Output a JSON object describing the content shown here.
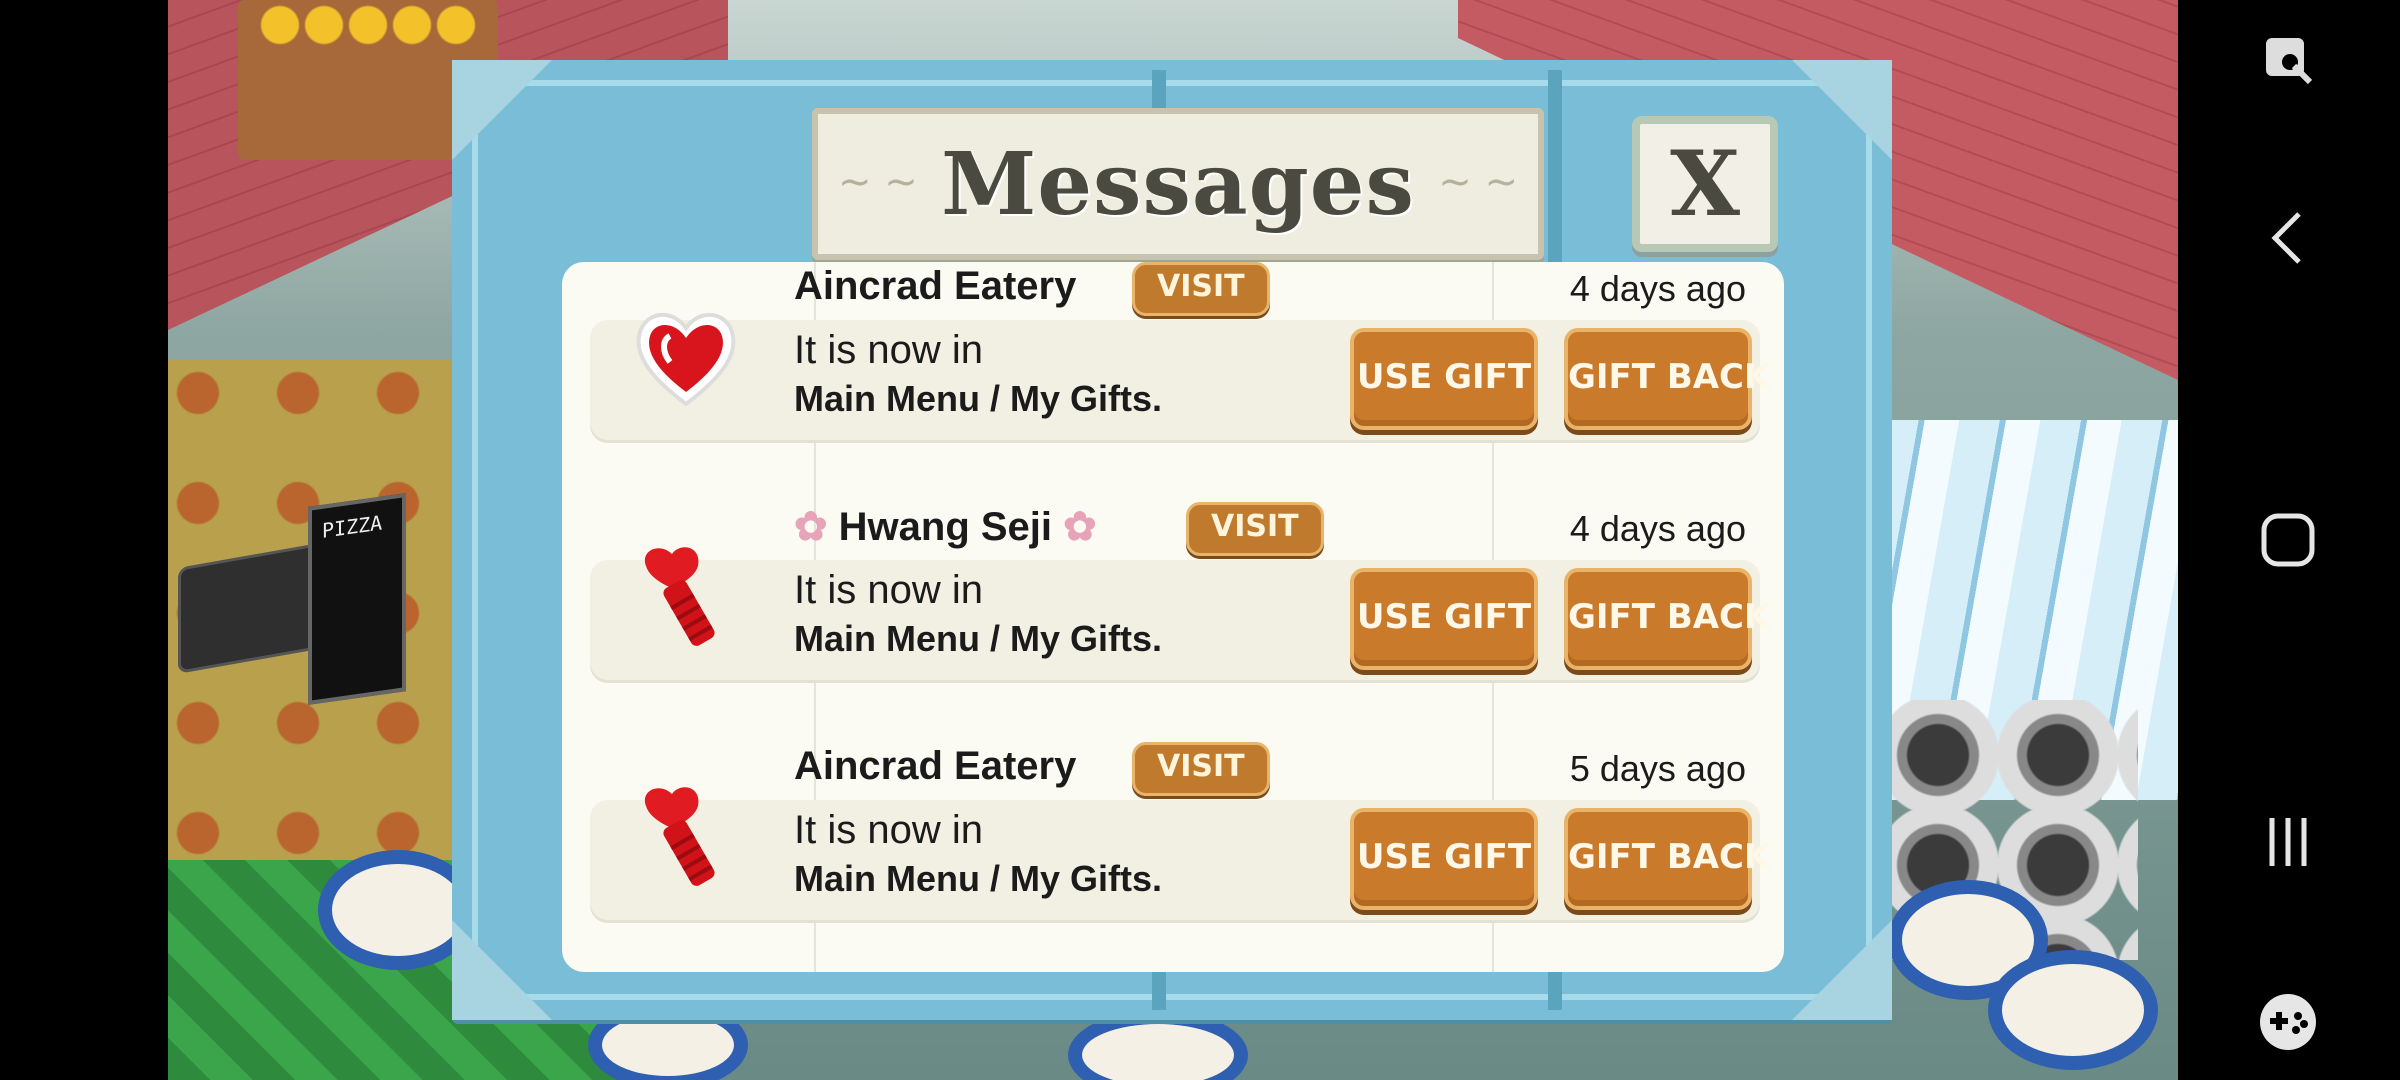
{
  "dialog": {
    "title": "Messages",
    "close_label": "X"
  },
  "messages": [
    {
      "sender": "Aincrad Eatery",
      "sender_decorated": false,
      "icon": "heart-icon",
      "visit_label": "VISIT",
      "time": "4 days ago",
      "line1": "It is now in",
      "line2": "Main Menu / My Gifts.",
      "use_label": "USE GIFT",
      "back_label": "GIFT BACK"
    },
    {
      "sender": "Hwang Seji",
      "sender_decorated": true,
      "icon": "heart-screw-icon",
      "visit_label": "VISIT",
      "time": "4 days ago",
      "line1": "It is now in",
      "line2": "Main Menu / My Gifts.",
      "use_label": "USE GIFT",
      "back_label": "GIFT BACK"
    },
    {
      "sender": "Aincrad Eatery",
      "sender_decorated": false,
      "icon": "heart-screw-icon",
      "visit_label": "VISIT",
      "time": "5 days ago",
      "line1": "It is now in",
      "line2": "Main Menu / My Gifts.",
      "use_label": "USE GIFT",
      "back_label": "GIFT BACK"
    }
  ],
  "scene": {
    "sign_text": "PIZZA"
  },
  "navbar": {
    "items": [
      "screenshot-edit-icon",
      "back-icon",
      "home-icon",
      "recents-icon",
      "game-tools-icon"
    ]
  }
}
